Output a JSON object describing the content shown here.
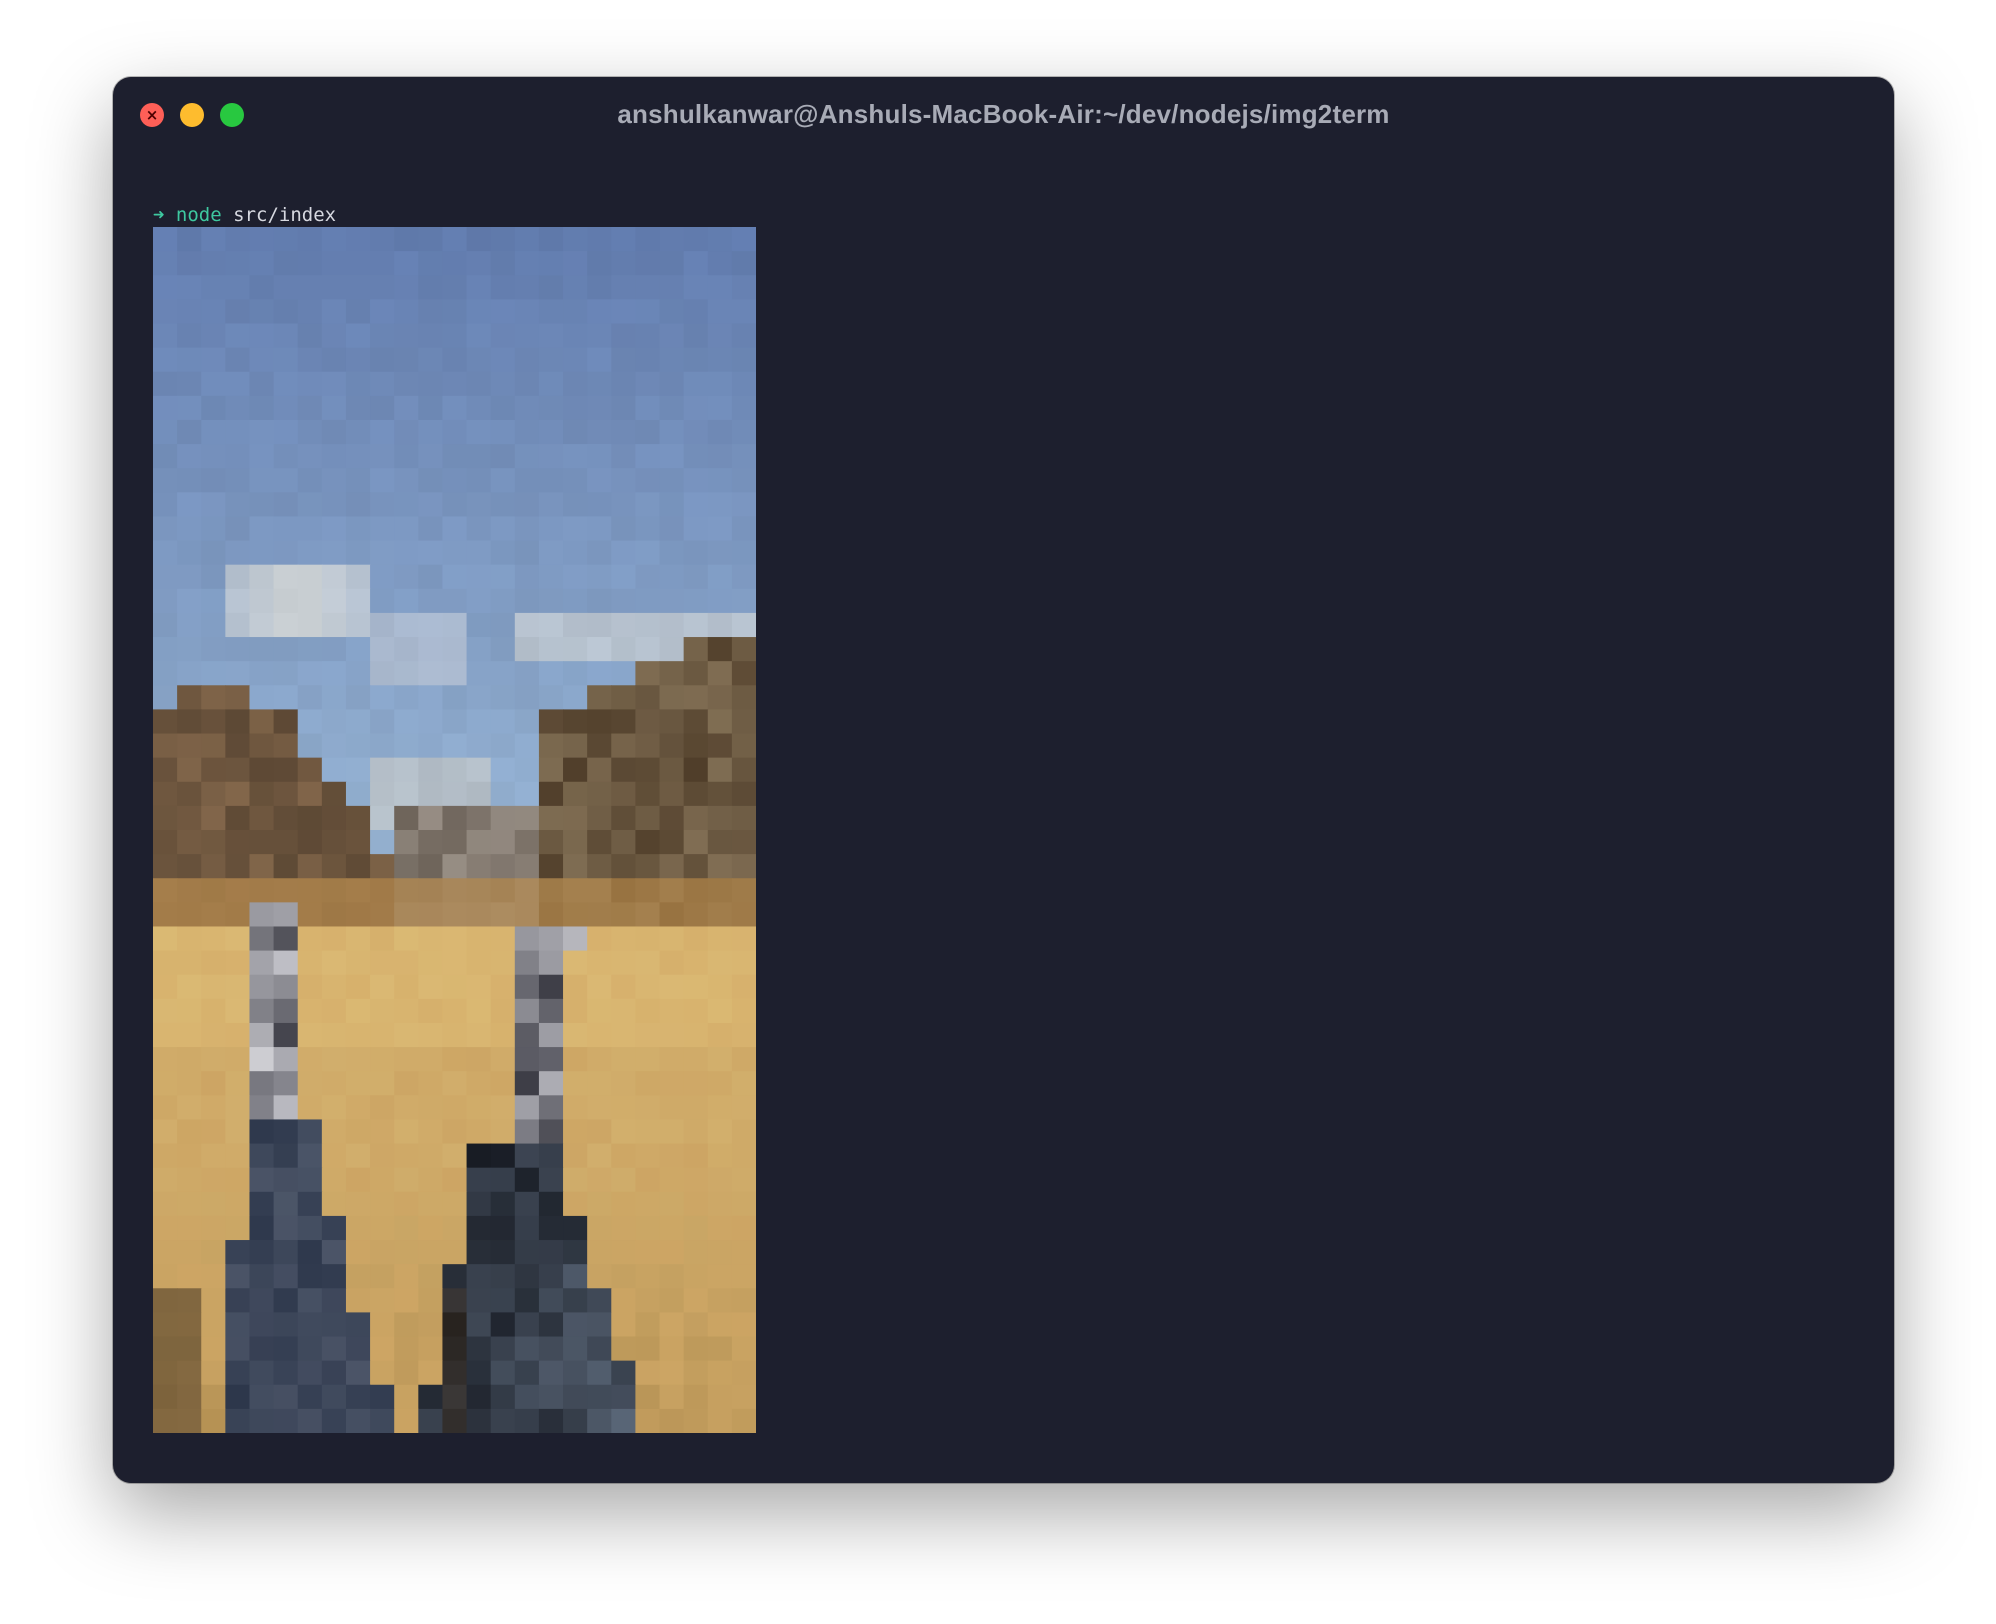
{
  "window": {
    "title": "anshulkanwar@Anshuls-MacBook-Air:~/dev/nodejs/img2term"
  },
  "traffic_lights": {
    "close_icon": "×",
    "close_color": "#fe5f57",
    "minimize_color": "#febc2e",
    "maximize_color": "#28c840"
  },
  "terminal": {
    "prompt_symbol": "➜",
    "command_name": "node",
    "command_args": "src/index",
    "background": "#1d1f2e",
    "prompt_color": "#3ec8a0"
  },
  "output_image": {
    "icon": "pixelated-photo",
    "subject": "pixelated-photo"
  }
}
